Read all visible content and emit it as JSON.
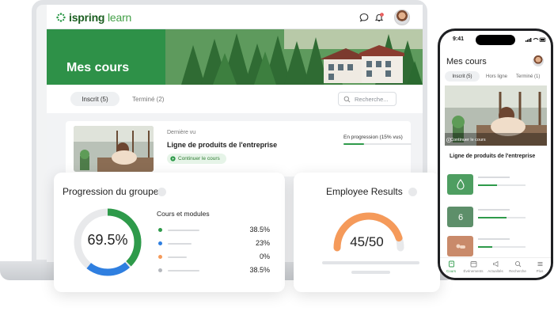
{
  "laptop": {
    "logo": {
      "brand": "ispring",
      "product": "learn"
    },
    "notifications_badge": "1",
    "banner_title": "Mes cours",
    "tabs": [
      {
        "label": "Inscrit (5)",
        "active": true
      },
      {
        "label": "Terminé (2)",
        "active": false
      }
    ],
    "search_placeholder": "Recherche...",
    "course": {
      "label": "Dernière vu",
      "title": "Ligne de produits de l'entreprise",
      "cta": "Continuer le cours",
      "progress_text": "En progression (15% vus)",
      "progress": 0.3
    }
  },
  "progress_card": {
    "title": "Progression du groupe",
    "value": "69.5%",
    "legend_title": "Cours et modules",
    "items": [
      {
        "color": "#2e9a4a",
        "value": "38.5%"
      },
      {
        "color": "#2f7fe0",
        "value": "23%"
      },
      {
        "color": "#f59a5a",
        "value": "0%"
      },
      {
        "color": "#b5b8bd",
        "value": "38.5%"
      }
    ],
    "segments": [
      {
        "color": "#2e9a4a",
        "fraction": 0.385
      },
      {
        "color": "#2f7fe0",
        "fraction": 0.23
      }
    ]
  },
  "results_card": {
    "title": "Employee Results",
    "value": "45/50",
    "score": 45,
    "max": 50,
    "color": "#f59a5a"
  },
  "phone": {
    "time": "9:41",
    "title": "Mes cours",
    "tabs": [
      "Inscrit (5)",
      "Hors ligne",
      "Terminé (1)"
    ],
    "hero_cta": "Continuer le cours",
    "course_title": "Ligne de produits de l'entreprise",
    "rows": [
      {
        "color": "#4e9e61",
        "icon": "drop-icon",
        "progress": 0.4
      },
      {
        "color": "#5d8f6a",
        "icon": "number-six-icon",
        "progress": 0.6
      },
      {
        "color": "#c98a6a",
        "icon": "massage-icon",
        "progress": 0.3
      }
    ],
    "nav": [
      {
        "label": "Cours",
        "active": true
      },
      {
        "label": "Événements",
        "active": false
      },
      {
        "label": "Actualités",
        "active": false
      },
      {
        "label": "Recherche",
        "active": false
      },
      {
        "label": "Plus",
        "active": false
      }
    ]
  },
  "colors": {
    "accent": "#2e9a4a",
    "orange": "#f59a5a",
    "blue": "#2f7fe0"
  }
}
